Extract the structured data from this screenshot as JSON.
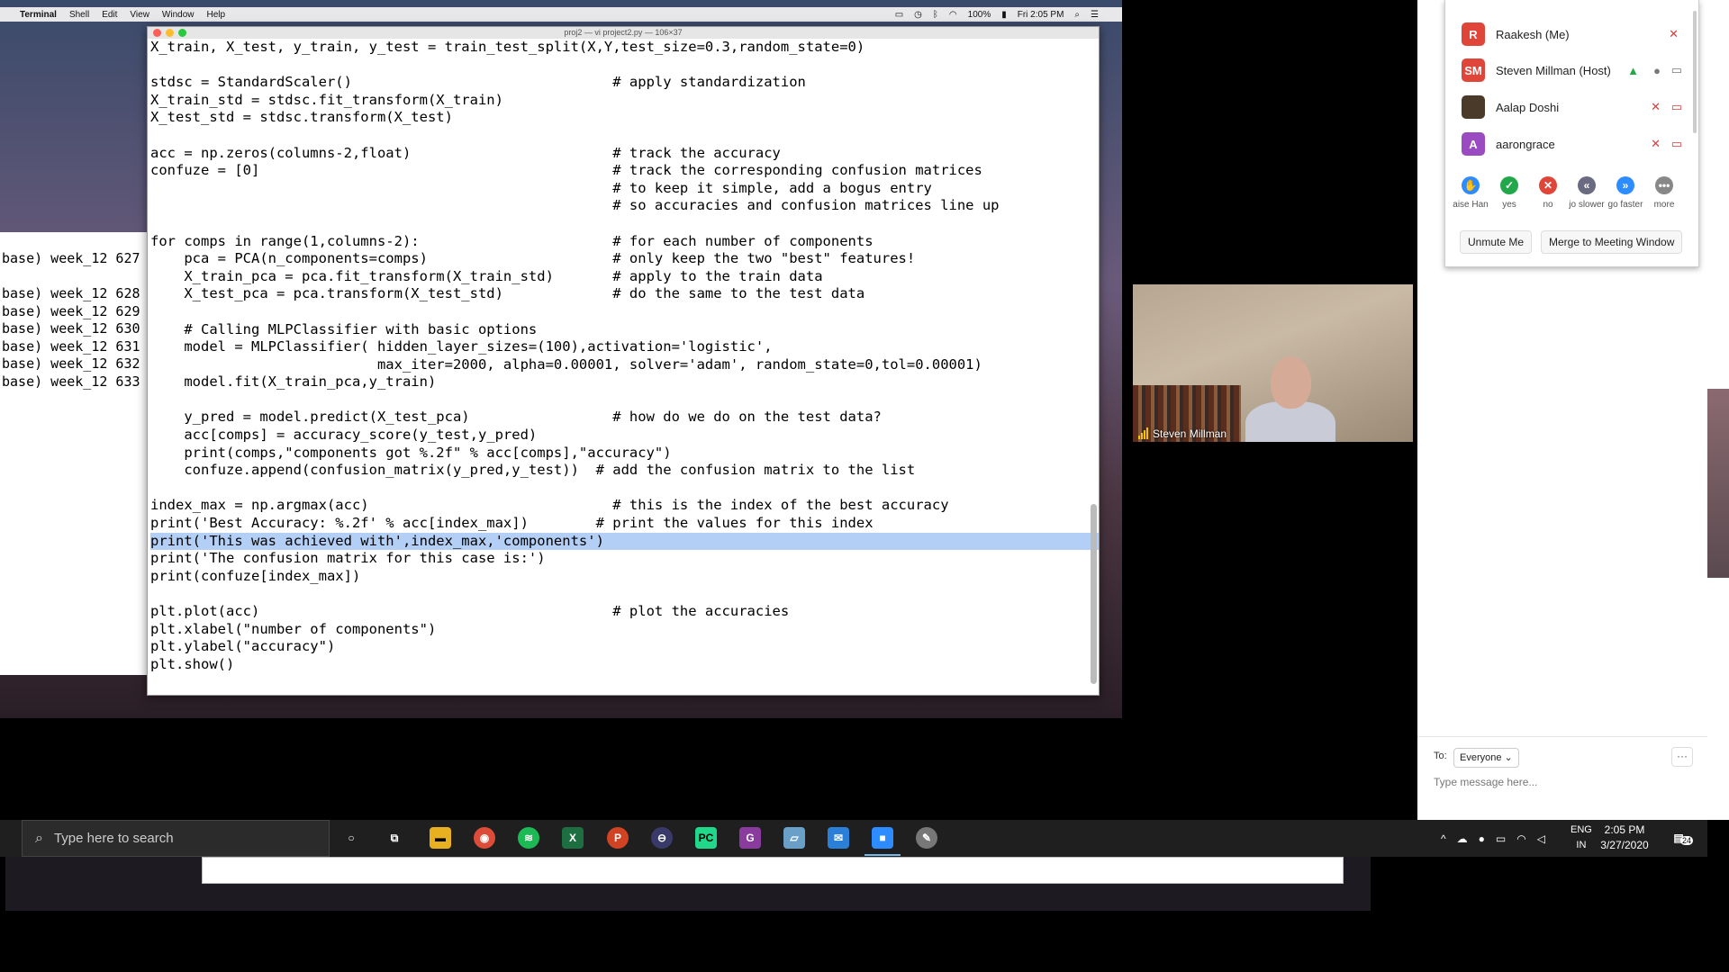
{
  "mac_menubar": {
    "apple": "",
    "items": [
      "Terminal",
      "Shell",
      "Edit",
      "View",
      "Window",
      "Help"
    ],
    "battery": "100%",
    "clock": "Fri 2:05 PM"
  },
  "terminal": {
    "title": "proj2 — vi project2.py — 106×37",
    "lines": [
      "X_train, X_test, y_train, y_test = train_test_split(X,Y,test_size=0.3,random_state=0)",
      "",
      "stdsc = StandardScaler()                               # apply standardization",
      "X_train_std = stdsc.fit_transform(X_train)",
      "X_test_std = stdsc.transform(X_test)",
      "",
      "acc = np.zeros(columns-2,float)                        # track the accuracy",
      "confuze = [0]                                          # track the corresponding confusion matrices",
      "                                                       # to keep it simple, add a bogus entry",
      "                                                       # so accuracies and confusion matrices line up",
      "",
      "for comps in range(1,columns-2):                       # for each number of components",
      "    pca = PCA(n_components=comps)                      # only keep the two \"best\" features!",
      "    X_train_pca = pca.fit_transform(X_train_std)       # apply to the train data",
      "    X_test_pca = pca.transform(X_test_std)             # do the same to the test data",
      "",
      "    # Calling MLPClassifier with basic options",
      "    model = MLPClassifier( hidden_layer_sizes=(100),activation='logistic',",
      "                           max_iter=2000, alpha=0.00001, solver='adam', random_state=0,tol=0.00001)",
      "    model.fit(X_train_pca,y_train)",
      "",
      "    y_pred = model.predict(X_test_pca)                 # how do we do on the test data?",
      "    acc[comps] = accuracy_score(y_test,y_pred)",
      "    print(comps,\"components got %.2f\" % acc[comps],\"accuracy\")",
      "    confuze.append(confusion_matrix(y_pred,y_test))  # add the confusion matrix to the list",
      "",
      "index_max = np.argmax(acc)                             # this is the index of the best accuracy",
      "print('Best Accuracy: %.2f' % acc[index_max])        # print the values for this index",
      "print('This was achieved with',index_max,'components')",
      "print('The confusion matrix for this case is:')",
      "print(confuze[index_max])",
      "",
      "plt.plot(acc)                                          # plot the accuracies",
      "plt.xlabel(\"number of components\")",
      "plt.ylabel(\"accuracy\")",
      "plt.show()"
    ],
    "highlight_line": 28
  },
  "bg_terminal": {
    "lines": [
      "base) week_12 627",
      "",
      "base) week_12 628",
      "base) week_12 629",
      "base) week_12 630",
      "base) week_12 631",
      "base) week_12 632",
      "base) week_12 633"
    ]
  },
  "video": {
    "name": "Steven Millman"
  },
  "participants": [
    {
      "initials": "R",
      "name": "Raakesh (Me)",
      "color": "#e0453a"
    },
    {
      "initials": "SM",
      "name": "Steven Millman (Host)",
      "color": "#e0453a"
    },
    {
      "initials": "",
      "name": "Aalap Doshi",
      "color": "#4a3a2a"
    },
    {
      "initials": "A",
      "name": "aarongrace",
      "color": "#9a4bc2"
    }
  ],
  "reactions": [
    {
      "label": "aise Han",
      "icon": "raise-hand-icon",
      "symbol": "✋",
      "color": "#2d8cff"
    },
    {
      "label": "yes",
      "icon": "check-icon",
      "symbol": "✓",
      "color": "#22a84a"
    },
    {
      "label": "no",
      "icon": "x-icon",
      "symbol": "✕",
      "color": "#e0453a"
    },
    {
      "label": "jo slower",
      "icon": "rewind-icon",
      "symbol": "«",
      "color": "#6a6a80"
    },
    {
      "label": "go faster",
      "icon": "fast-forward-icon",
      "symbol": "»",
      "color": "#2d8cff"
    },
    {
      "label": "more",
      "icon": "more-icon",
      "symbol": "•••",
      "color": "#888"
    }
  ],
  "buttons": {
    "unmute": "Unmute Me",
    "merge": "Merge to Meeting Window"
  },
  "chat": {
    "to_label": "To:",
    "recipient": "Everyone",
    "recipient_chevron": "⌄",
    "more": "···",
    "placeholder": "Type message here..."
  },
  "taskbar": {
    "search_placeholder": "Type here to search",
    "lang_top": "ENG",
    "lang_bottom": "IN",
    "time": "2:05 PM",
    "date": "3/27/2020",
    "notifications": "24"
  }
}
